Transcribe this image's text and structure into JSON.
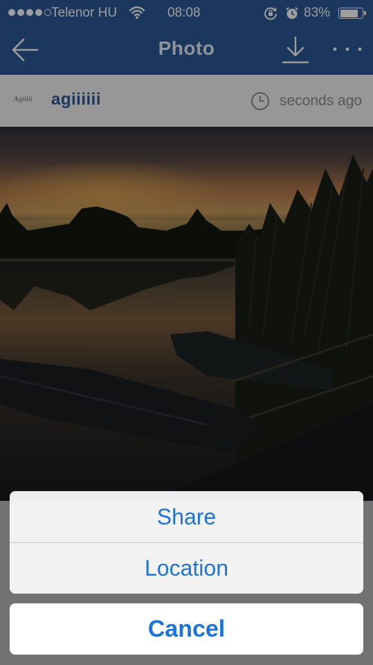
{
  "status_bar": {
    "carrier": "Telenor HU",
    "time": "08:08",
    "battery": "83%",
    "battery_level": 0.83,
    "signal_bars": 4,
    "signal_max": 5
  },
  "nav": {
    "title": "Photo",
    "back_icon": "arrow-left-icon",
    "download_icon": "download-icon",
    "more_icon": "more-dots-icon"
  },
  "post": {
    "avatar_text": "Agiiiii",
    "username": "agiiiiii",
    "timestamp": "seconds ago"
  },
  "action_sheet": {
    "share_label": "Share",
    "location_label": "Location",
    "cancel_label": "Cancel"
  },
  "colors": {
    "nav_blue": "#2c5a98",
    "action_blue": "#1e73d8"
  }
}
